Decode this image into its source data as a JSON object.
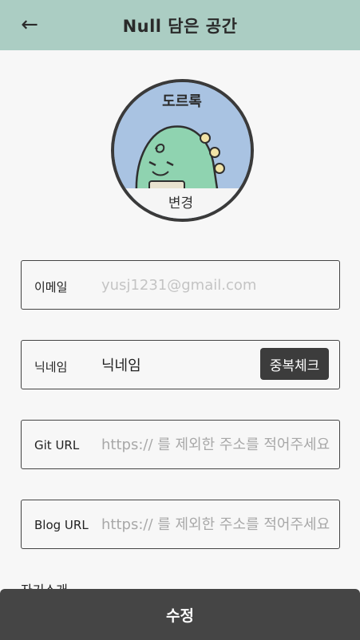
{
  "header": {
    "title": "Null 담은 공간",
    "back_icon": "←"
  },
  "profile": {
    "image_alt": "도르록",
    "change_label": "변경",
    "change_icon": "pencil-icon"
  },
  "form": {
    "email": {
      "label": "이메일",
      "placeholder": "yusj1231@gmail.com"
    },
    "nickname": {
      "label": "닉네임",
      "value": "닉네임",
      "check_button": "중복체크"
    },
    "git": {
      "label": "Git URL",
      "placeholder": "https:// 를 제외한 주소를 적어주세요"
    },
    "blog": {
      "label": "Blog URL",
      "placeholder": "https:// 를 제외한 주소를 적어주세요"
    },
    "intro_label": "자기소개"
  },
  "submit": {
    "label": "수정"
  },
  "colors": {
    "header_bg": "#abcdc3",
    "submit_bg": "#454545",
    "avatar_bg": "#a9c3e2",
    "dino": "#8fd3b0"
  }
}
